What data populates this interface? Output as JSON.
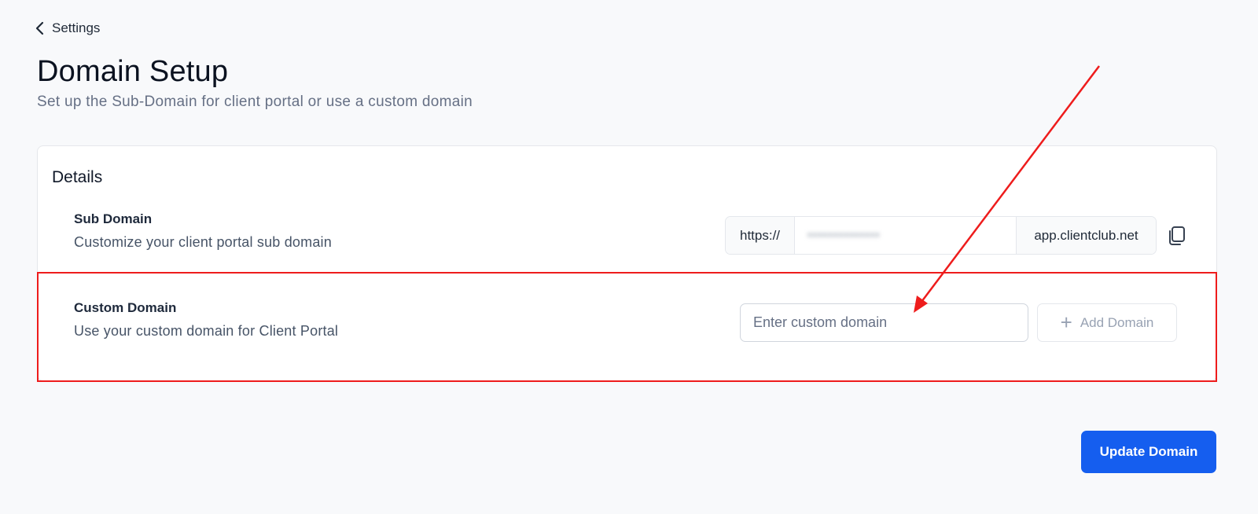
{
  "nav": {
    "back_label": "Settings"
  },
  "header": {
    "title": "Domain Setup",
    "subtitle": "Set up the Sub-Domain for client portal or use a custom domain"
  },
  "details": {
    "title": "Details",
    "sub_domain": {
      "title": "Sub Domain",
      "description": "Customize your client portal sub domain",
      "prefix": "https://",
      "value_obscured": "••••••••••••••",
      "suffix": "app.clientclub.net"
    },
    "custom_domain": {
      "title": "Custom Domain",
      "description": "Use your custom domain for Client Portal",
      "input_placeholder": "Enter custom domain",
      "input_value": "",
      "add_button_label": "Add Domain"
    }
  },
  "actions": {
    "update_label": "Update Domain"
  },
  "annotation": {
    "color": "#ee1c1c"
  },
  "colors": {
    "primary": "#155eef"
  }
}
